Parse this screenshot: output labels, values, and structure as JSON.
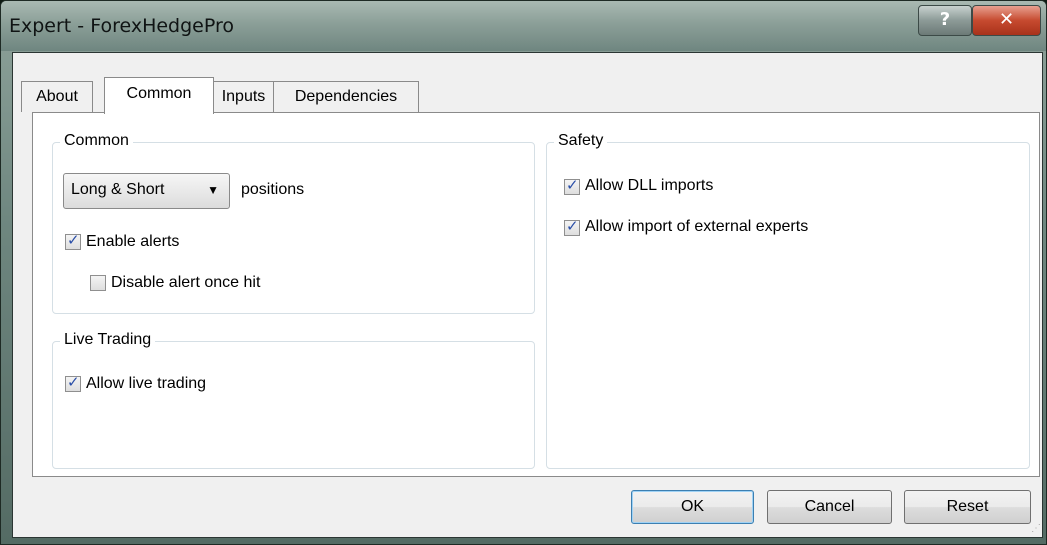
{
  "window": {
    "title": "Expert - ForexHedgePro",
    "help_label": "?",
    "close_label": "✕"
  },
  "tabs": [
    {
      "label": "About"
    },
    {
      "label": "Common"
    },
    {
      "label": "Inputs"
    },
    {
      "label": "Dependencies"
    }
  ],
  "common": {
    "group_label": "Common",
    "positions_select": "Long & Short",
    "positions_label": "positions",
    "enable_alerts": {
      "label": "Enable alerts",
      "checked": true
    },
    "disable_alert_once_hit": {
      "label": "Disable alert once hit",
      "checked": false
    }
  },
  "live_trading": {
    "group_label": "Live Trading",
    "allow_live_trading": {
      "label": "Allow live trading",
      "checked": true
    }
  },
  "safety": {
    "group_label": "Safety",
    "allow_dll_imports": {
      "label": "Allow DLL imports",
      "checked": true
    },
    "allow_import_external": {
      "label": "Allow import of external experts",
      "checked": true
    }
  },
  "buttons": {
    "ok": "OK",
    "cancel": "Cancel",
    "reset": "Reset"
  }
}
